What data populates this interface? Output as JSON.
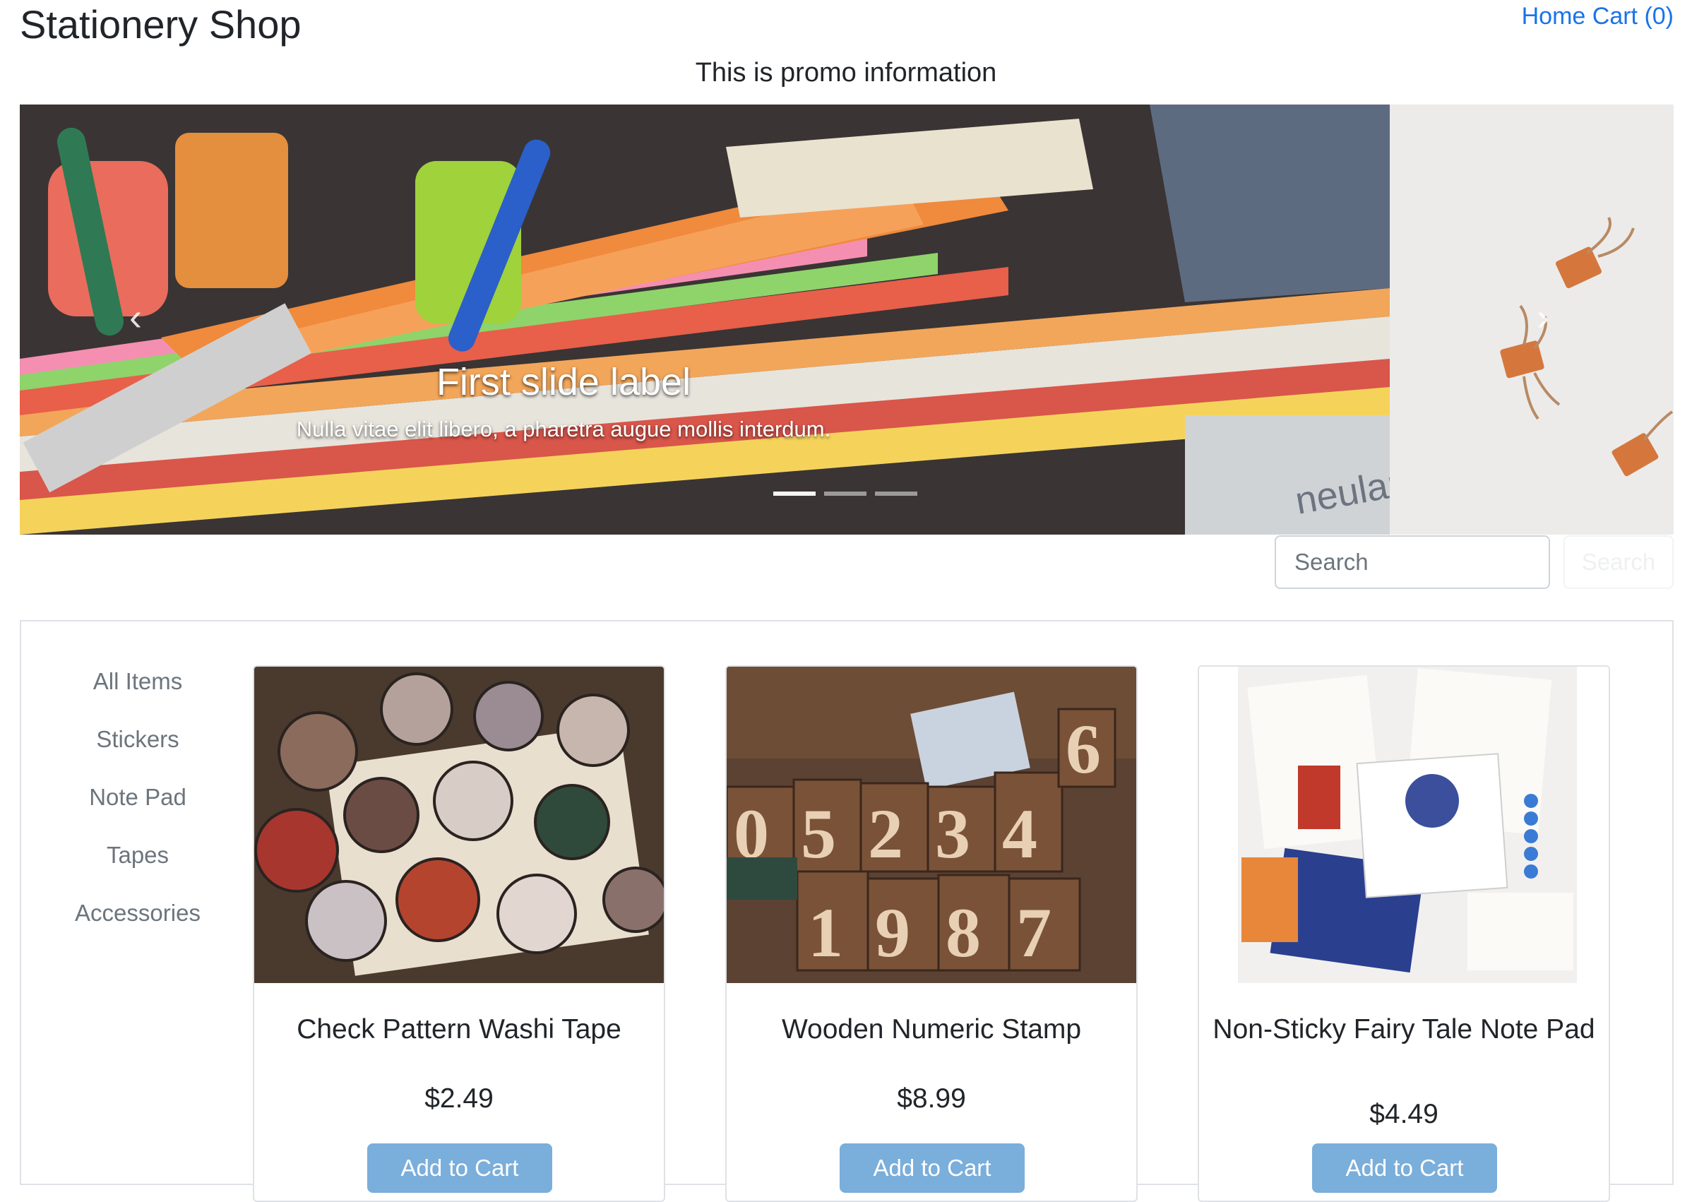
{
  "header": {
    "brand": "Stationery Shop",
    "nav": {
      "home": "Home",
      "cart": "Cart (0)"
    }
  },
  "promo": "This is promo information",
  "carousel": {
    "caption_title": "First slide label",
    "caption_text": "Nulla vitae elit libero, a pharetra augue mollis interdum.",
    "slide_count": 3,
    "active_slide": 1
  },
  "search": {
    "placeholder": "Search",
    "button_label": "Search"
  },
  "categories": [
    "All Items",
    "Stickers",
    "Note Pad",
    "Tapes",
    "Accessories"
  ],
  "products": [
    {
      "title": "Check Pattern Washi Tape",
      "price": "$2.49",
      "button": "Add to Cart"
    },
    {
      "title": "Wooden Numeric Stamp",
      "price": "$8.99",
      "button": "Add to Cart"
    },
    {
      "title": "Non-Sticky Fairy Tale Note Pad",
      "price": "$4.49",
      "button": "Add to Cart"
    }
  ],
  "colors": {
    "link": "#1a73e8",
    "button": "#7aaedb",
    "muted": "#6c757d"
  }
}
